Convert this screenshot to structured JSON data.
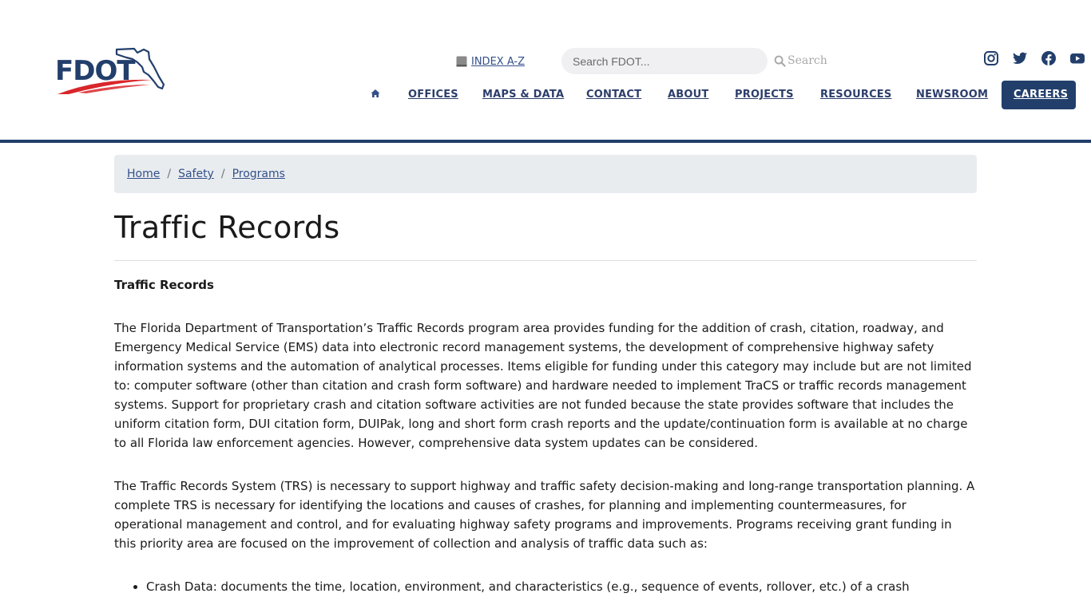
{
  "header": {
    "logo_text": "FDOT",
    "index_link": "INDEX A-Z",
    "search_placeholder": "Search FDOT...",
    "search_button": "Search",
    "social_icons": [
      "instagram-icon",
      "twitter-icon",
      "facebook-icon",
      "youtube-icon"
    ],
    "nav": {
      "home_icon": "home-icon",
      "items": [
        "OFFICES",
        "MAPS & DATA",
        "CONTACT",
        "ABOUT",
        "PROJECTS",
        "RESOURCES",
        "NEWSROOM",
        "CAREERS"
      ]
    }
  },
  "breadcrumb": [
    "Home",
    "Safety",
    "Programs"
  ],
  "page": {
    "title": "Traffic Records",
    "subhead": "Traffic Records",
    "paragraphs": [
      "The Florida Department of Transportation’s Traffic Records program area provides funding for the addition of crash, citation, roadway, and Emergency Medical Service (EMS) data into electronic record management systems, the development of comprehensive highway safety information systems and the automation of analytical processes. Items eligible for funding under this category may include but are not limited to: computer software (other than citation and crash form software) and hardware needed to implement TraCS or traffic records management systems. Support for proprietary crash and citation software activities are not funded because the state provides software that includes the uniform citation form, DUI citation form, DUIPak, long and short form crash reports and the update/continuation form is available at no charge to all Florida law enforcement agencies. However, comprehensive data system updates can be considered.",
      "The Traffic Records System (TRS) is necessary to support highway and traffic safety decision-making and long-range transportation planning. A complete TRS is necessary for identifying the locations and causes of crashes, for planning and implementing countermeasures, for operational management and control, and for evaluating highway safety programs and improvements. Programs receiving grant funding in this priority area are focused on the improvement of collection and analysis of traffic data such as:"
    ],
    "list": [
      "Crash Data: documents the time, location, environment, and characteristics (e.g., sequence of events, rollover, etc.) of a crash"
    ]
  },
  "colors": {
    "brand_navy": "#223f6c",
    "nav_text": "#2c3e6b",
    "link": "#33508a",
    "logo_red": "#d8262b",
    "breadcrumb_bg": "#e9ecef"
  }
}
